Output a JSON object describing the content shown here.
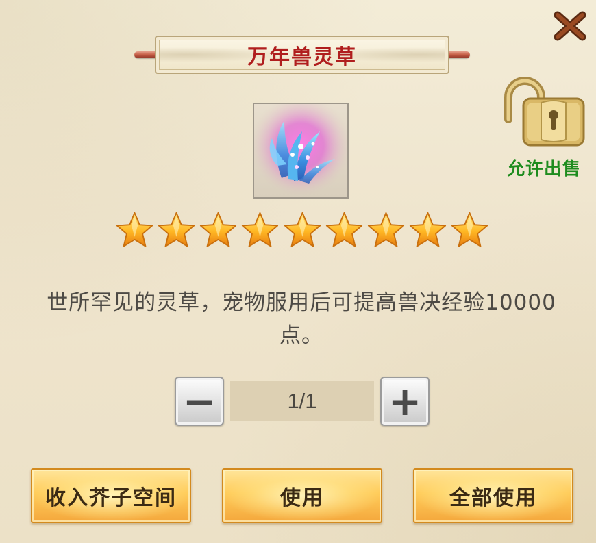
{
  "dialog": {
    "title": "万年兽灵草",
    "close_icon": "close-icon",
    "lock": {
      "icon": "unlocked-padlock-icon",
      "label": "允许出售"
    },
    "item": {
      "icon": "spirit-herb-icon",
      "rating": {
        "stars": 9,
        "max_stars": 9
      }
    },
    "description_line1": "世所罕见的灵草，宠物服用后可提高兽决经验10000",
    "description_line2": "点。",
    "quantity": {
      "display": "1/1",
      "minus_label": "−",
      "plus_label": "+"
    },
    "buttons": {
      "store_label": "收入芥子空间",
      "use_label": "使用",
      "use_all_label": "全部使用"
    },
    "colors": {
      "title": "#b01e1e",
      "lock_label": "#1e8c1e",
      "button_gold": "#ffcc5a"
    }
  }
}
